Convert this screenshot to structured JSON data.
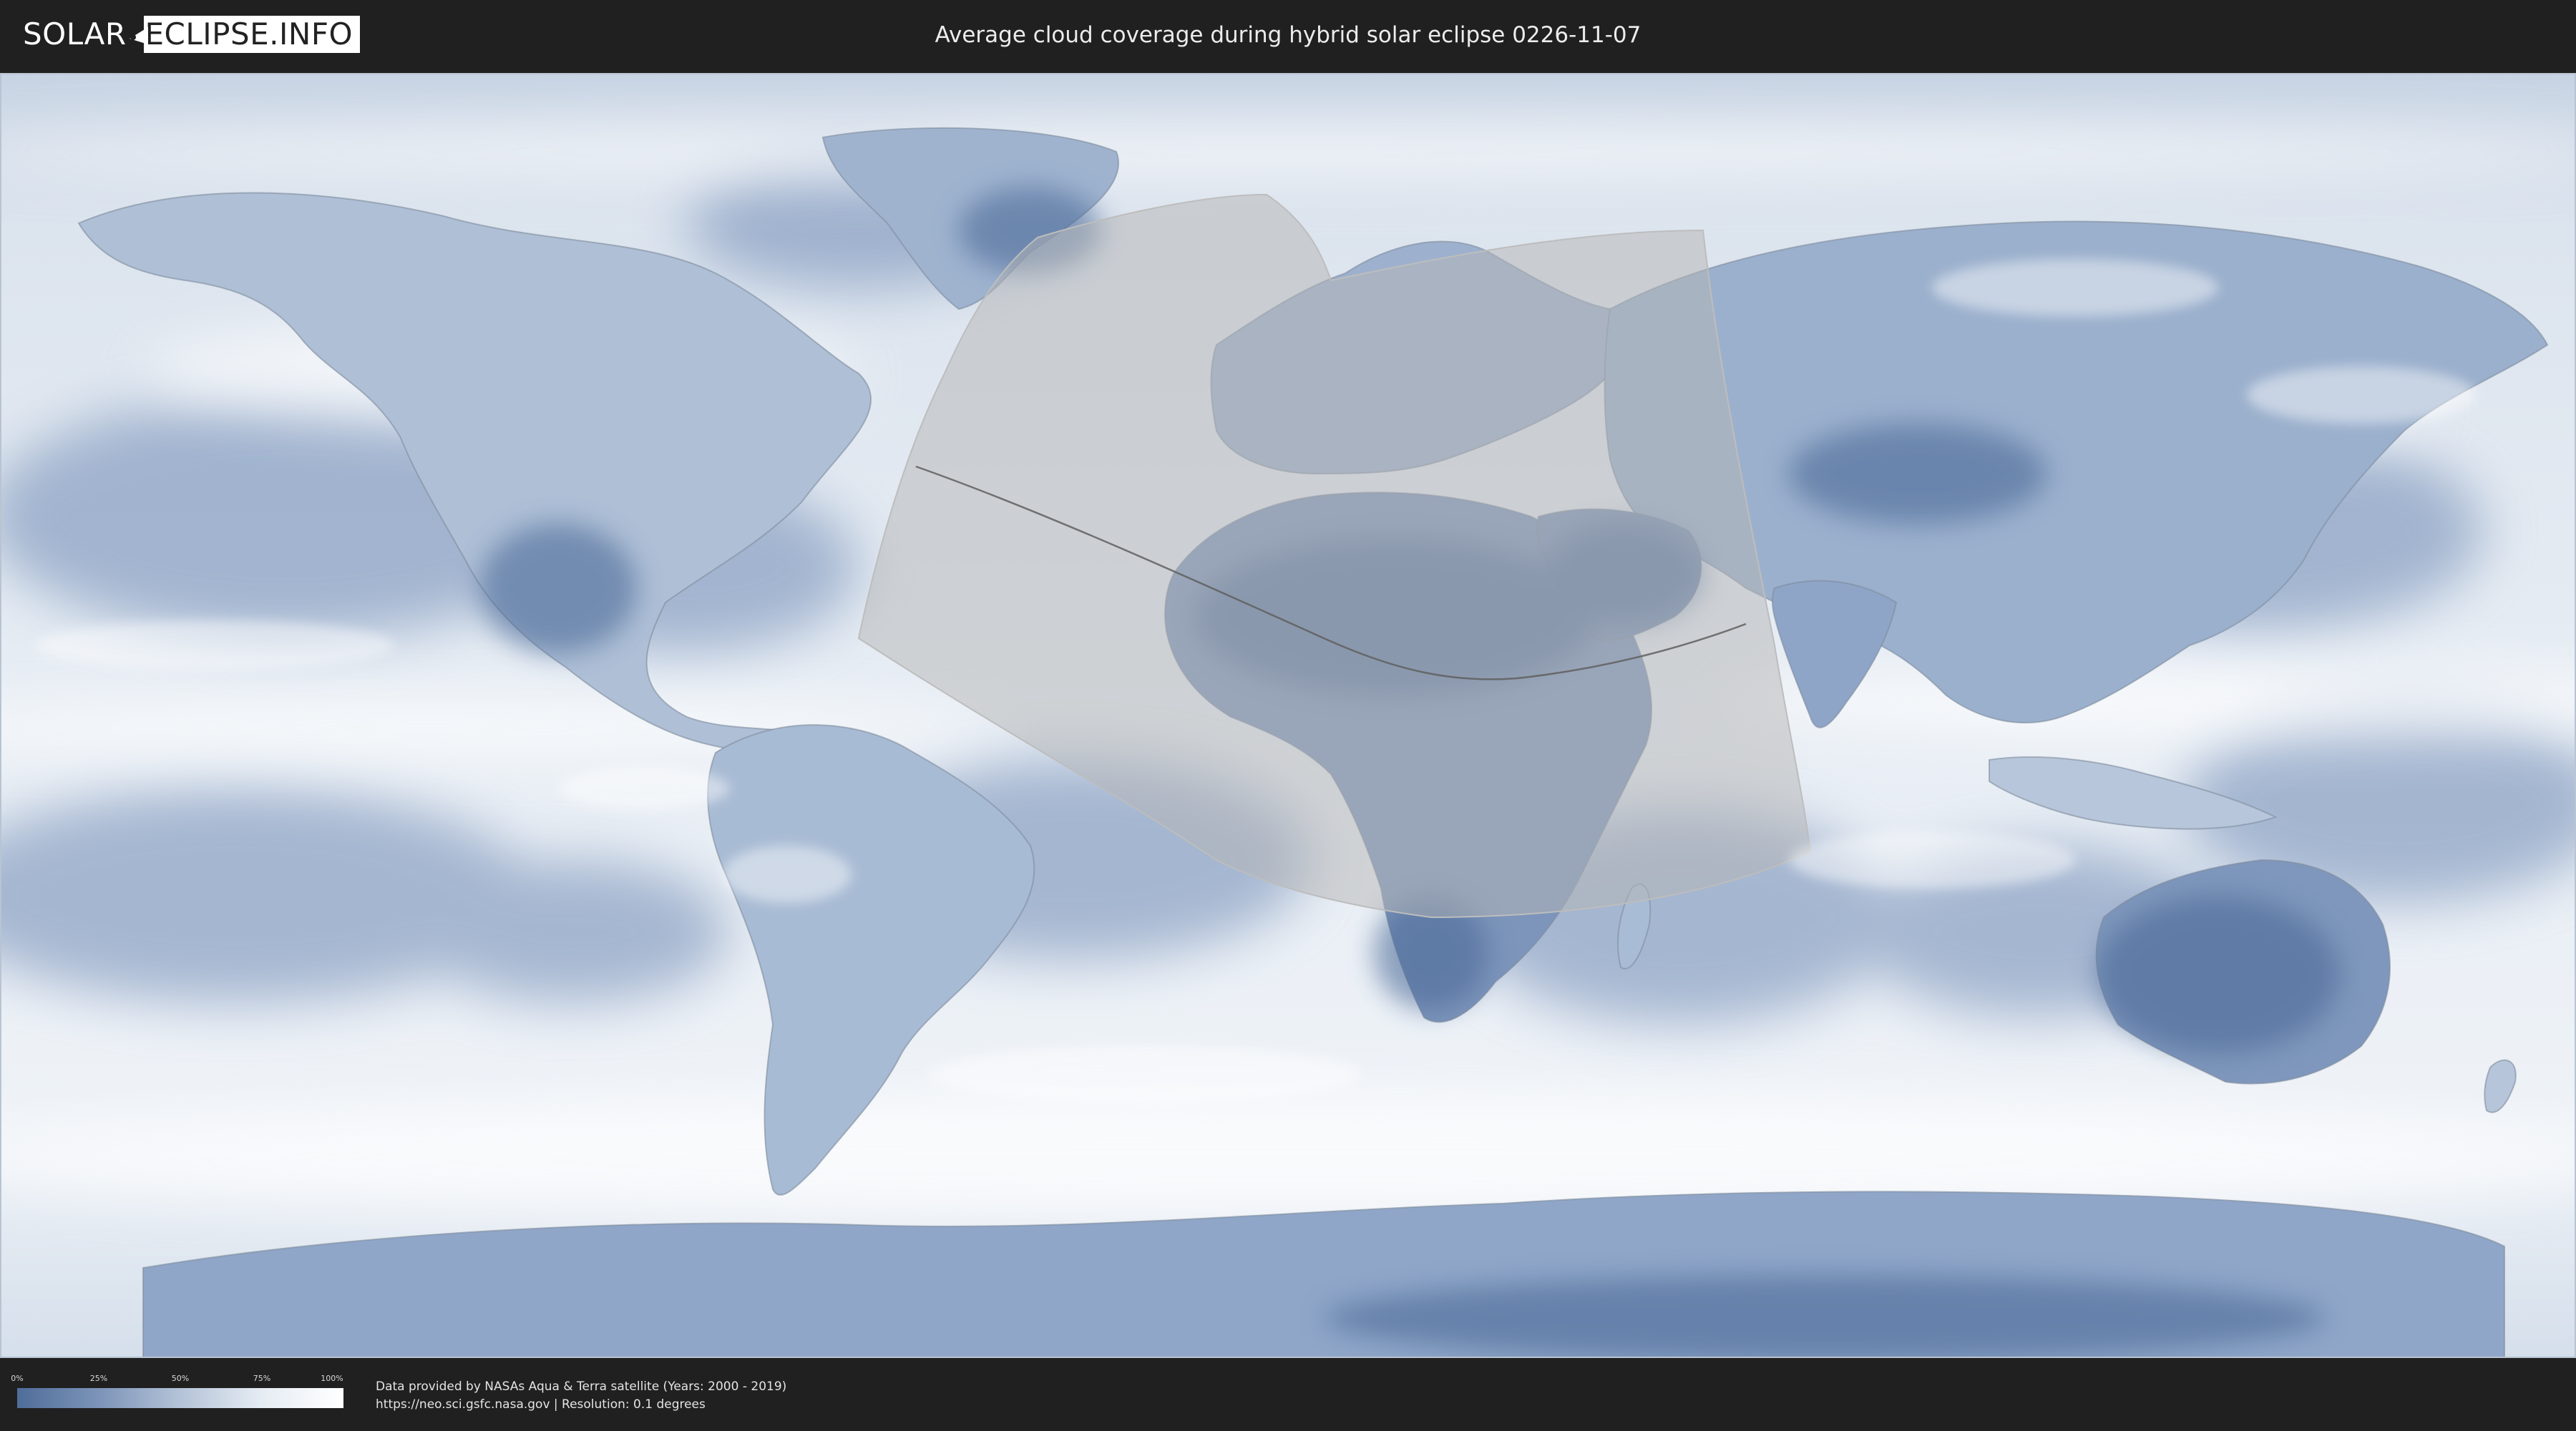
{
  "header": {
    "logo_part1": "SOLAR",
    "logo_part2": "ECLIPSE.INFO",
    "title": "Average cloud coverage during hybrid solar eclipse 0226-11-07"
  },
  "legend": {
    "ticks": [
      "0%",
      "25%",
      "50%",
      "75%",
      "100%"
    ],
    "tick_values": [
      0,
      25,
      50,
      75,
      100
    ],
    "colors": [
      "#4f6d9a",
      "#7c94b8",
      "#b4c3d8",
      "#e6ecf3",
      "#ffffff"
    ]
  },
  "footer": {
    "source_line1": "Data provided by NASAs Aqua & Terra satellite (Years: 2000 - 2019)",
    "source_line2": "https://neo.sci.gsfc.nasa.gov | Resolution: 0.1 degrees"
  },
  "map": {
    "projection": "equirectangular",
    "base_color": "#e9eef5",
    "cloud_low_color": "#5b79a6",
    "eclipse_zone_color": "#a9a9a9",
    "path_line_color": "#555555"
  }
}
